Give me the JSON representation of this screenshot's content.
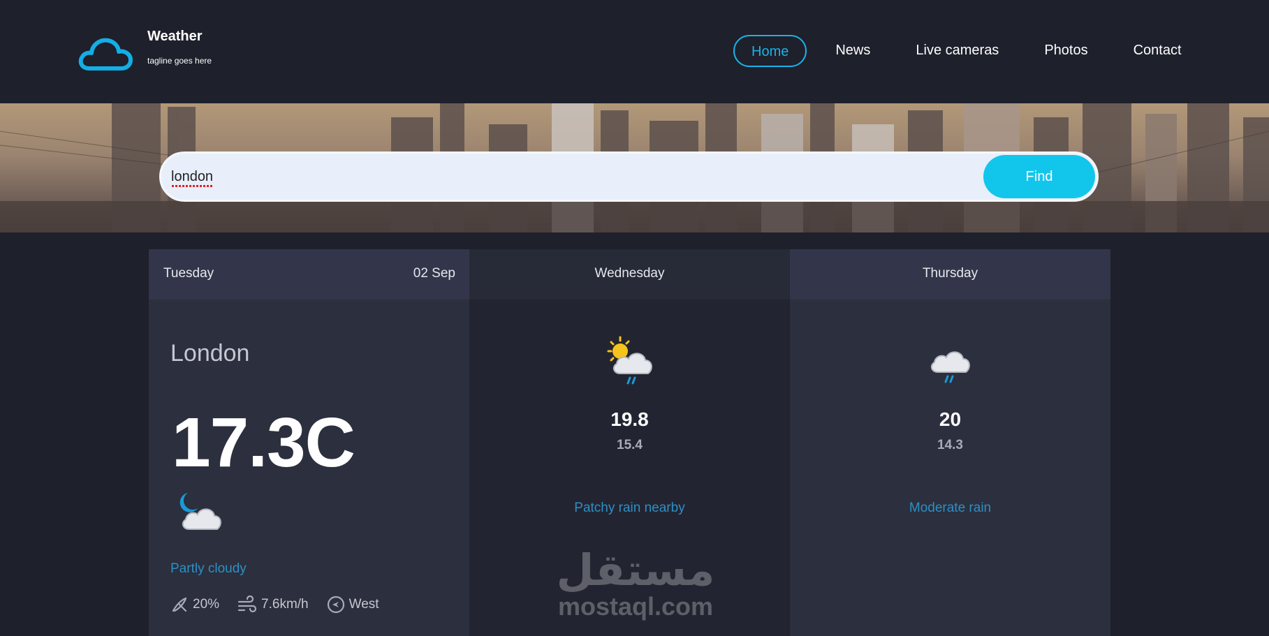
{
  "brand": {
    "title": "Weather",
    "tagline": "tagline goes here",
    "logo_icon": "cloud-icon"
  },
  "nav": {
    "items": [
      {
        "label": "Home",
        "active": true
      },
      {
        "label": "News",
        "active": false
      },
      {
        "label": "Live cameras",
        "active": false
      },
      {
        "label": "Photos",
        "active": false
      },
      {
        "label": "Contact",
        "active": false
      }
    ]
  },
  "search": {
    "value": "london",
    "button_label": "Find"
  },
  "today": {
    "day": "Tuesday",
    "date": "02 Sep",
    "city": "London",
    "temperature": "17.3C",
    "icon": "partly-cloudy-night-icon",
    "condition": "Partly cloudy",
    "rain_chance": "20%",
    "wind_speed": "7.6km/h",
    "wind_direction": "West"
  },
  "forecast": [
    {
      "day": "Wednesday",
      "icon": "patchy-rain-icon",
      "max": "19.8",
      "min": "15.4",
      "condition": "Patchy rain nearby"
    },
    {
      "day": "Thursday",
      "icon": "moderate-rain-icon",
      "max": "20",
      "min": "14.3",
      "condition": "Moderate rain"
    }
  ],
  "watermark": {
    "arabic": "مستقل",
    "latin": "mostaql.com"
  },
  "colors": {
    "background": "#1e202b",
    "accent": "#1ab2e8",
    "find_button": "#12c6eb",
    "condition_text": "#2d8fc6"
  }
}
